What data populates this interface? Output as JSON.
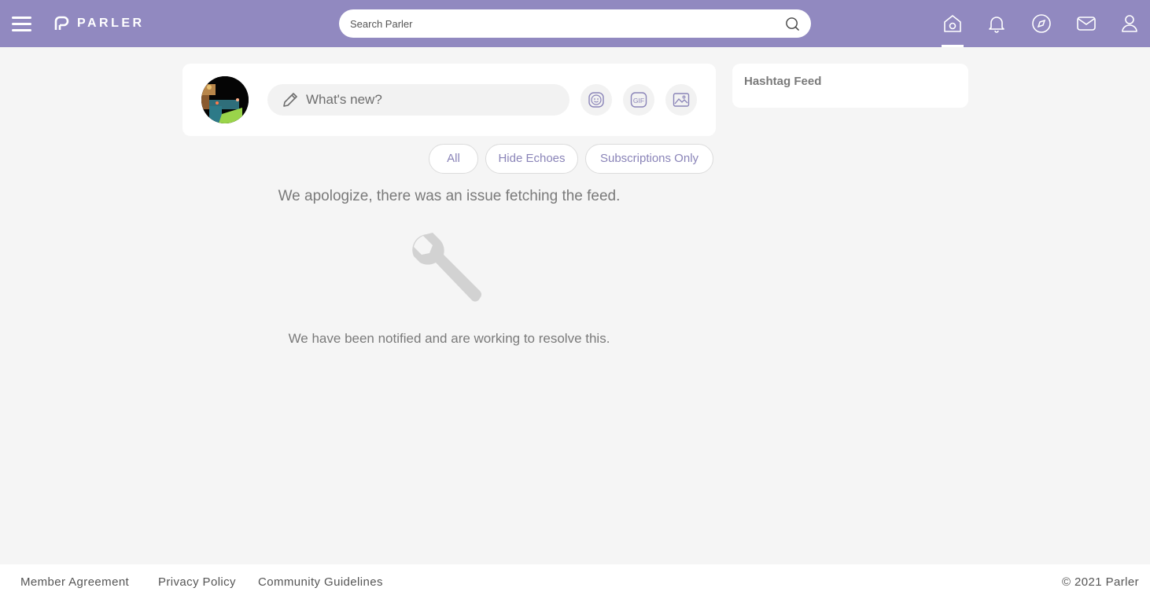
{
  "header": {
    "brand": "PARLER",
    "search_placeholder": "Search Parler",
    "background": "#9189c0",
    "nav_icons": [
      "home-icon",
      "bell-icon",
      "compass-icon",
      "mail-icon",
      "user-icon"
    ],
    "active_nav": "home-icon"
  },
  "composer": {
    "placeholder": "What's new?",
    "buttons": [
      "emoji-icon",
      "gif-icon",
      "image-icon"
    ],
    "gif_label": "GIF"
  },
  "filters": {
    "all": "All",
    "hide_echoes": "Hide Echoes",
    "subscriptions_only": "Subscriptions Only"
  },
  "feed": {
    "error_message": "We apologize, there was an issue fetching the feed.",
    "notice": "We have been notified and are working to resolve this.",
    "icon": "wrench-icon"
  },
  "sidebar": {
    "hashtag_title": "Hashtag Feed"
  },
  "footer": {
    "links": [
      "Member Agreement",
      "Privacy Policy",
      "Community Guidelines"
    ],
    "copyright": "© 2021 Parler"
  }
}
